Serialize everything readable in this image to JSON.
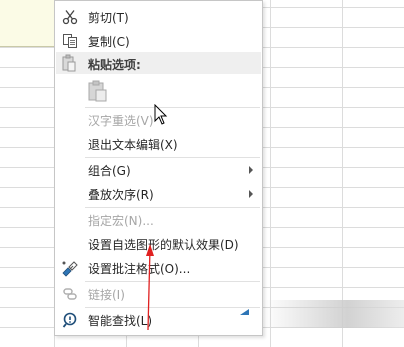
{
  "menu": {
    "cut": "剪切(T)",
    "copy": "复制(C)",
    "paste_options": "粘贴选项:",
    "hanzi_reselect": "汉字重选(V)",
    "exit_text_edit": "退出文本编辑(X)",
    "group": "组合(G)",
    "order": "叠放次序(R)",
    "assign_macro": "指定宏(N)...",
    "set_default_shape": "设置自选图形的默认效果(D)",
    "format_comment": "设置批注格式(O)...",
    "link": "链接(I)",
    "smart_lookup": "智能查找(L)"
  },
  "colors": {
    "accent": "#2e75b6",
    "annotation_arrow": "#e02020",
    "disabled_text": "#a6a6a6"
  },
  "icons": {
    "cut": "scissors-icon",
    "copy": "copy-icon",
    "paste": "clipboard-icon",
    "format_comment": "format-brush-icon",
    "link": "link-icon",
    "smart_lookup": "smart-lookup-icon"
  }
}
